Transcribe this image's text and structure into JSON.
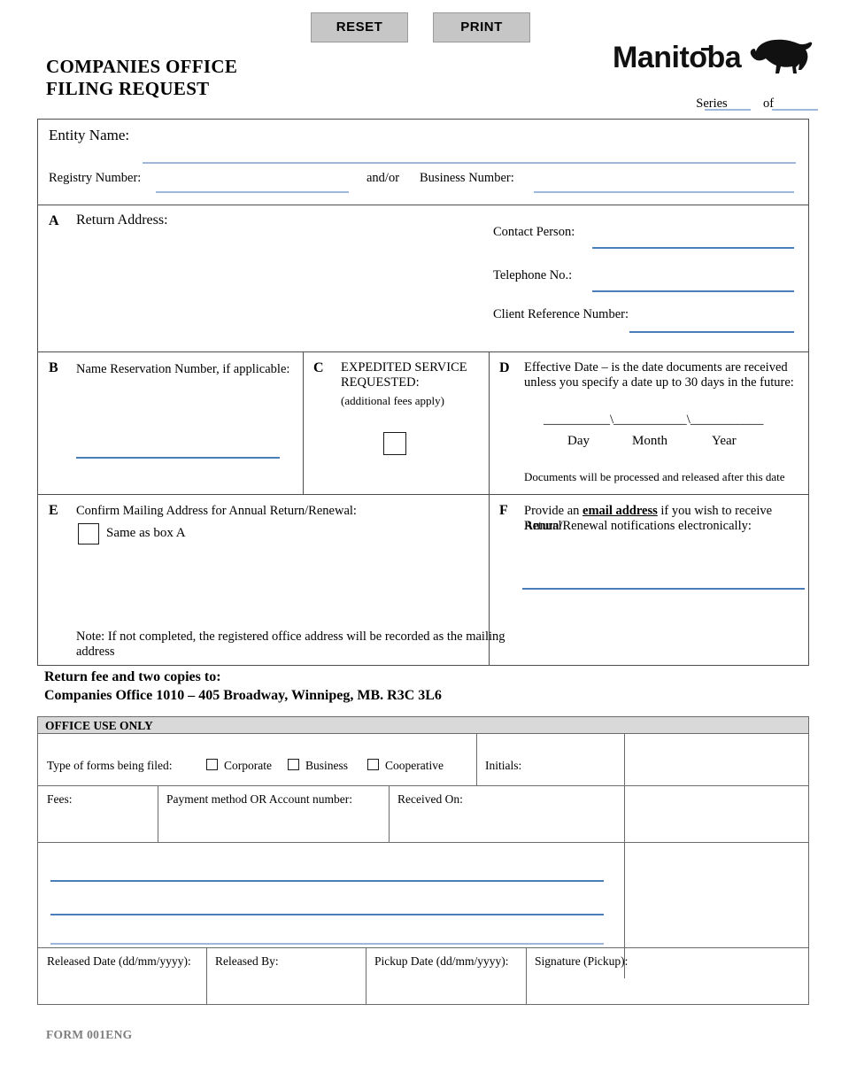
{
  "toolbar": {
    "reset_label": "RESET",
    "print_label": "PRINT"
  },
  "header": {
    "title_line1": "COMPANIES OFFICE",
    "title_line2": "FILING REQUEST",
    "logo_wordmark": "Manitoba",
    "series_label": "Series",
    "series_of_label": "of"
  },
  "entity": {
    "entity_name_label": "Entity Name:",
    "registry_number_label": "Registry  Number:",
    "andor_label": "and/or",
    "business_number_label": "Business Number:"
  },
  "box_a": {
    "letter": "A",
    "title": "Return Address:",
    "contact_person_label": "Contact Person:",
    "telephone_label": "Telephone No.:",
    "client_reference_label": "Client Reference Number:"
  },
  "box_b": {
    "letter": "B",
    "title": "Name Reservation Number, if applicable:"
  },
  "box_c": {
    "letter": "C",
    "title_line1": "EXPEDITED SERVICE",
    "title_line2": "REQUESTED:",
    "note": "(additional fees apply)"
  },
  "box_d": {
    "letter": "D",
    "title_line1": "Effective Date – is the date documents are received",
    "title_line2": "unless you specify a date up to 30 days in the future:",
    "date_line": "__________\\___________\\___________",
    "day_label": "Day",
    "month_label": "Month",
    "year_label": "Year",
    "note": "Documents will be processed and released after this date"
  },
  "box_e": {
    "letter": "E",
    "title": "Confirm Mailing Address for Annual Return/Renewal:",
    "same_as_box_a_label": "Same as box A",
    "note_line1": "Note: If not completed, the registered office address will be recorded as the mailing",
    "note_line2": "address"
  },
  "box_f": {
    "letter": "F",
    "text_before": "Provide an ",
    "text_emphasis": "email address",
    "text_after": " if you wish to receive Annual",
    "text_line2": "Return/Renewal notifications electronically:"
  },
  "return_fee": {
    "line1": "Return fee and two copies to:",
    "line2": "Companies Office 1010 – 405 Broadway, Winnipeg, MB.  R3C 3L6"
  },
  "office_use": {
    "header": "OFFICE USE ONLY",
    "type_of_forms_label": "Type of forms being filed:",
    "checkbox_corporate": "Corporate",
    "checkbox_business": "Business",
    "checkbox_cooperative": "Cooperative",
    "initials_label": "Initials:",
    "fees_label": "Fees:",
    "payment_method_label": "Payment method OR Account number:",
    "received_on_label": "Received On:",
    "released_date_label": "Released Date (dd/mm/yyyy):",
    "released_by_label": "Released By:",
    "pickup_date_label": "Pickup Date (dd/mm/yyyy):",
    "signature_pickup_label": "Signature (Pickup):"
  },
  "footer": {
    "form_code": "FORM 001ENG"
  },
  "colors": {
    "line_light_blue": "#9eb8dc",
    "line_blue": "#4a7ebb",
    "office_header_bg": "#d9d9d9",
    "button_bg": "#c6c6c6",
    "border": "#4d4d4d",
    "footer_text": "#7d7d7d"
  }
}
